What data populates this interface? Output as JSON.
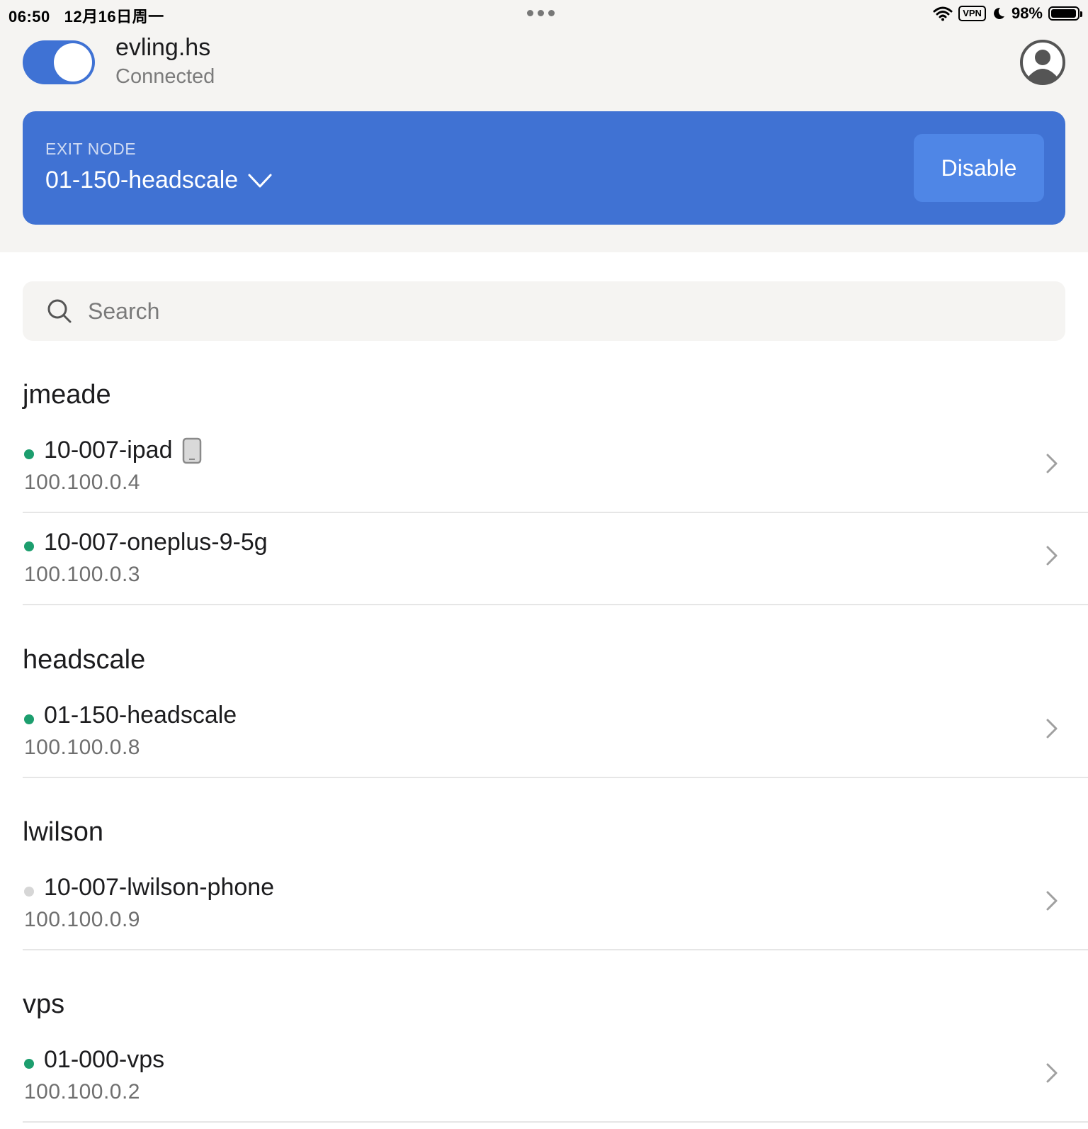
{
  "status_bar": {
    "time": "06:50",
    "date": "12月16日周一",
    "vpn": "VPN",
    "battery": "98%",
    "battery_level": 0.98
  },
  "header": {
    "tailnet_name": "evling.hs",
    "connection_status": "Connected",
    "toggle_on": true
  },
  "exit_node": {
    "label": "EXIT NODE",
    "value": "01-150-headscale",
    "disable_label": "Disable"
  },
  "search": {
    "placeholder": "Search",
    "value": ""
  },
  "groups": [
    {
      "name": "jmeade",
      "devices": [
        {
          "name": "10-007-ipad",
          "ip": "100.100.0.4",
          "online": true,
          "this_device_icon": "tablet-icon"
        },
        {
          "name": "10-007-oneplus-9-5g",
          "ip": "100.100.0.3",
          "online": true
        }
      ]
    },
    {
      "name": "headscale",
      "devices": [
        {
          "name": "01-150-headscale",
          "ip": "100.100.0.8",
          "online": true
        }
      ]
    },
    {
      "name": "lwilson",
      "devices": [
        {
          "name": "10-007-lwilson-phone",
          "ip": "100.100.0.9",
          "online": false
        }
      ]
    },
    {
      "name": "vps",
      "devices": [
        {
          "name": "01-000-vps",
          "ip": "100.100.0.2",
          "online": true
        }
      ]
    }
  ],
  "colors": {
    "accent": "#4072d3",
    "online": "#1c9e6e",
    "offline": "#d6d6d6"
  }
}
